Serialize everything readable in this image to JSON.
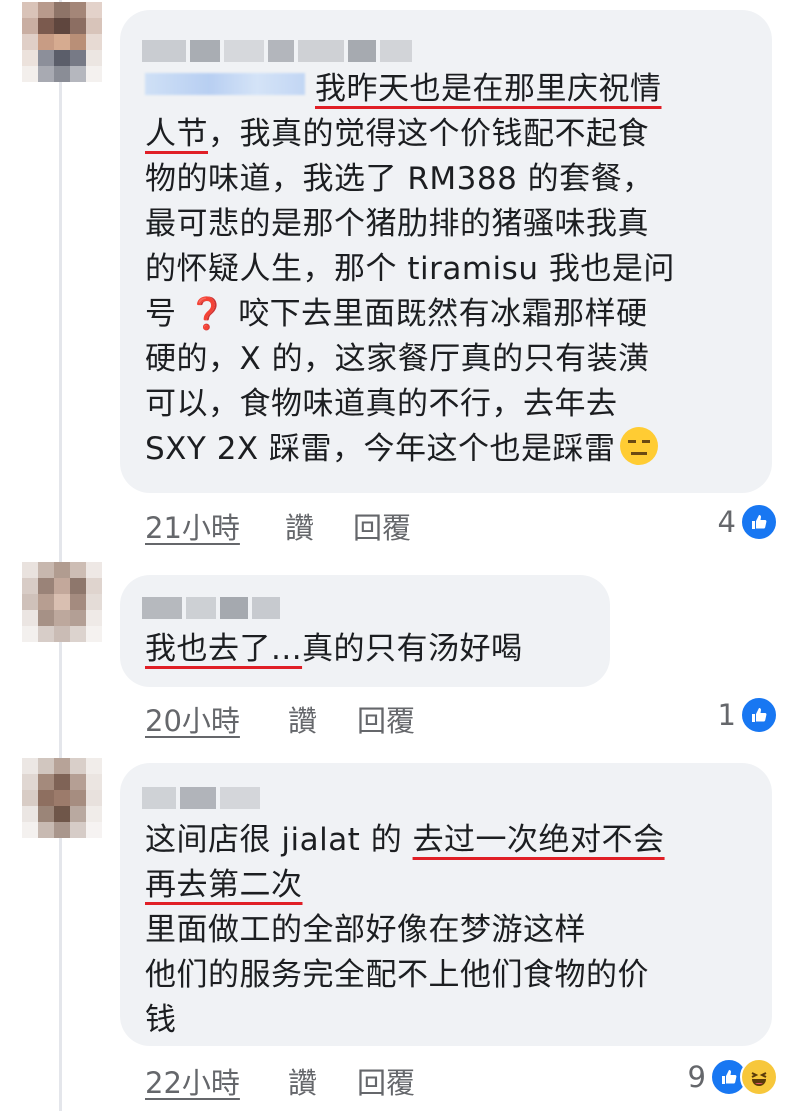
{
  "comments": [
    {
      "lines": [
        {
          "segments": [
            {
              "text": "我昨天也是在那里庆祝情",
              "underline": true
            }
          ]
        },
        {
          "segments": [
            {
              "text": "人节",
              "underline": true
            },
            {
              "text": "，我真的觉得这个价钱配不起食"
            }
          ]
        },
        {
          "segments": [
            {
              "text": "物的味道，我选了 RM388 的套餐，"
            }
          ]
        },
        {
          "segments": [
            {
              "text": "最可悲的是那个猪肋排的猪骚味我真"
            }
          ]
        },
        {
          "segments": [
            {
              "text": "的怀疑人生，那个 tiramisu 我也是问"
            }
          ]
        },
        {
          "segments": [
            {
              "text": "号"
            },
            {
              "text": " ❓ ",
              "red": true
            },
            {
              "text": "咬下去里面既然有冰霜那样硬"
            }
          ]
        },
        {
          "segments": [
            {
              "text": "硬的，X 的，这家餐厅真的只有装潢"
            }
          ]
        },
        {
          "segments": [
            {
              "text": "可以，食物味道真的不行，去年去"
            }
          ]
        },
        {
          "segments": [
            {
              "text": "SXY 2X 踩雷，今年这个也是踩雷"
            }
          ]
        }
      ],
      "emoji_icon": "expressionless-face-emoji",
      "time": "21小時",
      "like_label": "讚",
      "reply_label": "回覆",
      "reaction_count": "4",
      "reaction_icons": [
        "like-icon"
      ]
    },
    {
      "lines": [
        {
          "segments": [
            {
              "text": "我也去了...",
              "underline": true
            },
            {
              "text": "真的只有汤好喝"
            }
          ]
        }
      ],
      "time": "20小時",
      "like_label": "讚",
      "reply_label": "回覆",
      "reaction_count": "1",
      "reaction_icons": [
        "like-icon"
      ]
    },
    {
      "lines": [
        {
          "segments": [
            {
              "text": "这间店很 jialat 的 "
            },
            {
              "text": "去过一次绝对不会",
              "underline": true
            }
          ]
        },
        {
          "segments": [
            {
              "text": "再去第二次",
              "underline": true
            }
          ]
        },
        {
          "segments": [
            {
              "text": "里面做工的全部好像在梦游这样"
            }
          ]
        },
        {
          "segments": [
            {
              "text": "他们的服务完全配不上他们食物的价"
            }
          ]
        },
        {
          "segments": [
            {
              "text": "钱"
            }
          ]
        }
      ],
      "time": "22小時",
      "like_label": "讚",
      "reply_label": "回覆",
      "reaction_count": "9",
      "reaction_icons": [
        "like-icon",
        "haha-icon"
      ]
    }
  ],
  "colors": {
    "underline": "#e01f26",
    "like": "#1877f2",
    "haha": "#f7c73b",
    "bubble": "#f0f2f5",
    "meta_text": "#65676b"
  }
}
